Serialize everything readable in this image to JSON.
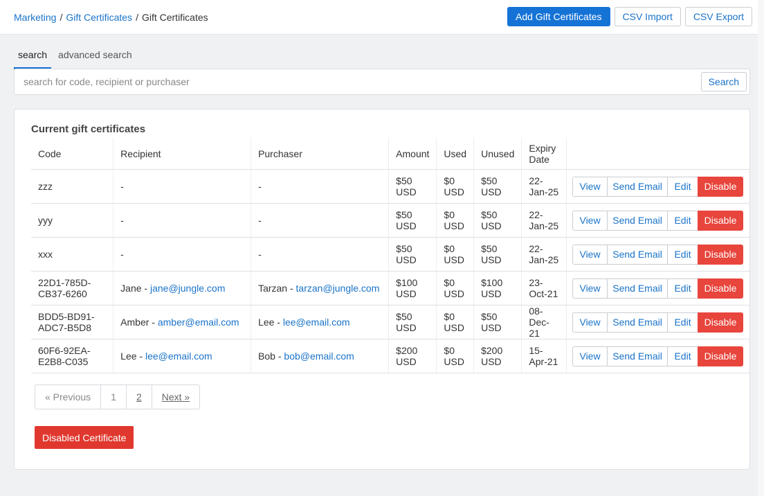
{
  "breadcrumb": {
    "items": [
      "Marketing",
      "Gift Certificates"
    ],
    "current": "Gift Certificates",
    "separator": "/"
  },
  "top_actions": {
    "add": "Add Gift Certificates",
    "csv_import": "CSV Import",
    "csv_export": "CSV Export"
  },
  "tabs": [
    "search",
    "advanced search"
  ],
  "search": {
    "placeholder": "search for code, recipient or purchaser",
    "value": "",
    "button": "Search"
  },
  "panel": {
    "title": "Current gift certificates"
  },
  "table": {
    "columns": {
      "code": "Code",
      "recipient": "Recipient",
      "purchaser": "Purchaser",
      "amount": "Amount",
      "used": "Used",
      "unused": "Unused",
      "expiry_1": "Expiry",
      "expiry_2": "Date"
    },
    "rows": [
      {
        "code_1": "zzz",
        "code_2": "",
        "recipient_name": "-",
        "recipient_email": "",
        "purchaser_name": "-",
        "purchaser_email": "",
        "amount": "$50",
        "used": "$0",
        "unused": "$50",
        "currency": "USD",
        "expiry_1": "22-",
        "expiry_2": "Jan-25"
      },
      {
        "code_1": "yyy",
        "code_2": "",
        "recipient_name": "-",
        "recipient_email": "",
        "purchaser_name": "-",
        "purchaser_email": "",
        "amount": "$50",
        "used": "$0",
        "unused": "$50",
        "currency": "USD",
        "expiry_1": "22-",
        "expiry_2": "Jan-25"
      },
      {
        "code_1": "xxx",
        "code_2": "",
        "recipient_name": "-",
        "recipient_email": "",
        "purchaser_name": "-",
        "purchaser_email": "",
        "amount": "$50",
        "used": "$0",
        "unused": "$50",
        "currency": "USD",
        "expiry_1": "22-",
        "expiry_2": "Jan-25"
      },
      {
        "code_1": "22D1-785D-",
        "code_2": "CB37-6260",
        "recipient_name": "Jane - ",
        "recipient_email": "jane@jungle.com",
        "purchaser_name": "Tarzan - ",
        "purchaser_email": "tarzan@jungle.com",
        "amount": "$100",
        "used": "$0",
        "unused": "$100",
        "currency": "USD",
        "expiry_1": "23-",
        "expiry_2": "Oct-21"
      },
      {
        "code_1": "BDD5-BD91-",
        "code_2": "ADC7-B5D8",
        "recipient_name": "Amber - ",
        "recipient_email": "amber@email.com",
        "purchaser_name": "Lee - ",
        "purchaser_email": "lee@email.com",
        "amount": "$50",
        "used": "$0",
        "unused": "$50",
        "currency": "USD",
        "expiry_1": "08-",
        "expiry_2": "Dec-21"
      },
      {
        "code_1": "60F6-92EA-",
        "code_2": "E2B8-C035",
        "recipient_name": "Lee - ",
        "recipient_email": "lee@email.com",
        "purchaser_name": "Bob - ",
        "purchaser_email": "bob@email.com",
        "amount": "$200",
        "used": "$0",
        "unused": "$200",
        "currency": "USD",
        "expiry_1": "15-",
        "expiry_2": "Apr-21"
      }
    ],
    "row_actions": {
      "view": "View",
      "send_email": "Send Email",
      "edit": "Edit",
      "disable": "Disable"
    }
  },
  "pagination": {
    "previous": "« Previous",
    "pages": [
      "1",
      "2"
    ],
    "next": "Next »"
  },
  "disabled_certificate_button": "Disabled Certificate",
  "colors": {
    "primary": "#1673d6",
    "link": "#1a73c8",
    "danger": "#e8453c",
    "background": "#f0f1f3"
  }
}
